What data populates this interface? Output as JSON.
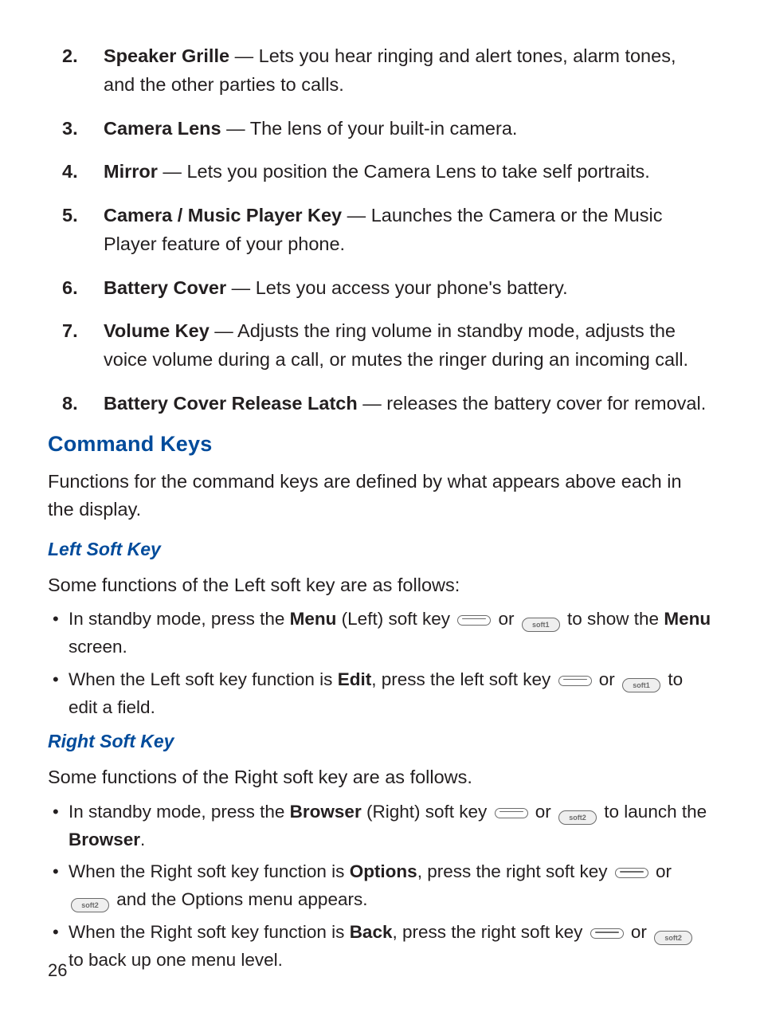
{
  "list": {
    "items": [
      {
        "num": "2.",
        "term": "Speaker Grille",
        "sep": " — ",
        "desc": "Lets you hear ringing and alert tones, alarm tones, and the other parties to calls."
      },
      {
        "num": "3.",
        "term": "Camera Lens",
        "sep": " — ",
        "desc": "The lens of your built-in camera."
      },
      {
        "num": "4.",
        "term": "Mirror",
        "sep": " — ",
        "desc": "Lets you position the Camera Lens to take self portraits."
      },
      {
        "num": "5.",
        "term": "Camera / Music Player Key",
        "sep": " — ",
        "desc": "Launches the Camera or the Music Player feature of your phone."
      },
      {
        "num": "6.",
        "term": "Battery Cover",
        "sep": " — ",
        "desc": "Lets you access your phone's battery."
      },
      {
        "num": "7.",
        "term": "Volume Key",
        "sep": " — ",
        "desc": "Adjusts the ring volume in standby mode, adjusts the voice volume during a call, or mutes the ringer during an incoming call."
      },
      {
        "num": "8.",
        "term": "Battery Cover Release Latch",
        "sep": " — ",
        "desc": "releases the battery cover for removal."
      }
    ]
  },
  "section": {
    "title": "Command Keys",
    "intro": "Functions for the command keys are defined by what appears above each in the display."
  },
  "left": {
    "heading": "Left Soft Key",
    "lead": "Some functions of the Left soft key are as follows:",
    "b1": {
      "pre": "In standby mode, press the ",
      "bold1": "Menu",
      "mid1": " (Left) soft key ",
      "or": " or ",
      "keylabel": "soft1",
      "mid2": " to show the ",
      "bold2": "Menu",
      "post": " screen."
    },
    "b2": {
      "pre": "When the Left soft key function is ",
      "bold1": "Edit",
      "mid1": ", press the left soft key ",
      "or": " or ",
      "keylabel": "soft1",
      "post": " to edit a field."
    }
  },
  "right": {
    "heading": "Right Soft Key",
    "lead": "Some functions of the Right soft key are as follows.",
    "b1": {
      "pre": "In standby mode, press the ",
      "bold1": "Browser",
      "mid1": " (Right) soft key ",
      "or": " or ",
      "keylabel": "soft2",
      "mid2": " to launch the ",
      "bold2": "Browser",
      "post": "."
    },
    "b2": {
      "pre": "When the Right soft key function is ",
      "bold1": "Options",
      "mid1": ", press the right soft key ",
      "or": " or ",
      "keylabel": "soft2",
      "post": " and the Options menu appears."
    },
    "b3": {
      "pre": "When the Right soft key function is ",
      "bold1": "Back",
      "mid1": ", press the right soft key ",
      "or": " or ",
      "keylabel": "soft2",
      "post": " to back up one menu level."
    }
  },
  "page_number": "26"
}
